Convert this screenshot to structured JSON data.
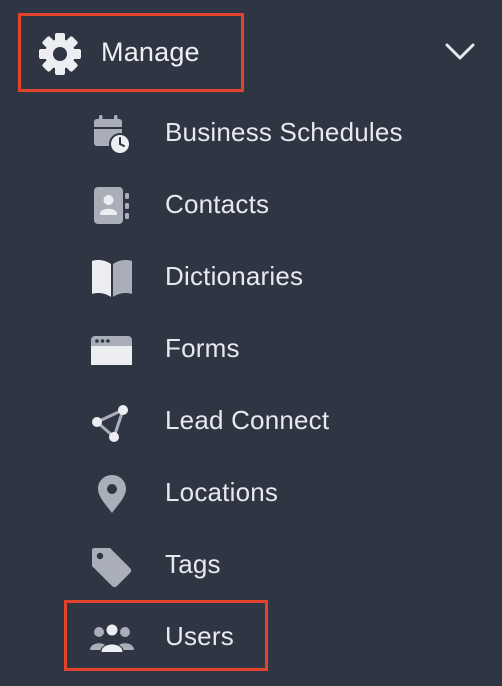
{
  "section": {
    "title": "Manage",
    "icon": "gear-icon",
    "expanded": true,
    "toggle_icon": "chevron-down-icon"
  },
  "menu": {
    "items": [
      {
        "label": "Business Schedules",
        "icon": "calendar-clock-icon"
      },
      {
        "label": "Contacts",
        "icon": "contact-book-icon"
      },
      {
        "label": "Dictionaries",
        "icon": "book-icon"
      },
      {
        "label": "Forms",
        "icon": "browser-window-icon"
      },
      {
        "label": "Lead Connect",
        "icon": "share-nodes-icon"
      },
      {
        "label": "Locations",
        "icon": "map-pin-icon"
      },
      {
        "label": "Tags",
        "icon": "tag-icon"
      },
      {
        "label": "Users",
        "icon": "users-icon"
      }
    ]
  },
  "colors": {
    "background": "#2f3543",
    "text": "#e7e9ee",
    "icon": "#a9aeb9",
    "highlight": "#e2432c"
  }
}
